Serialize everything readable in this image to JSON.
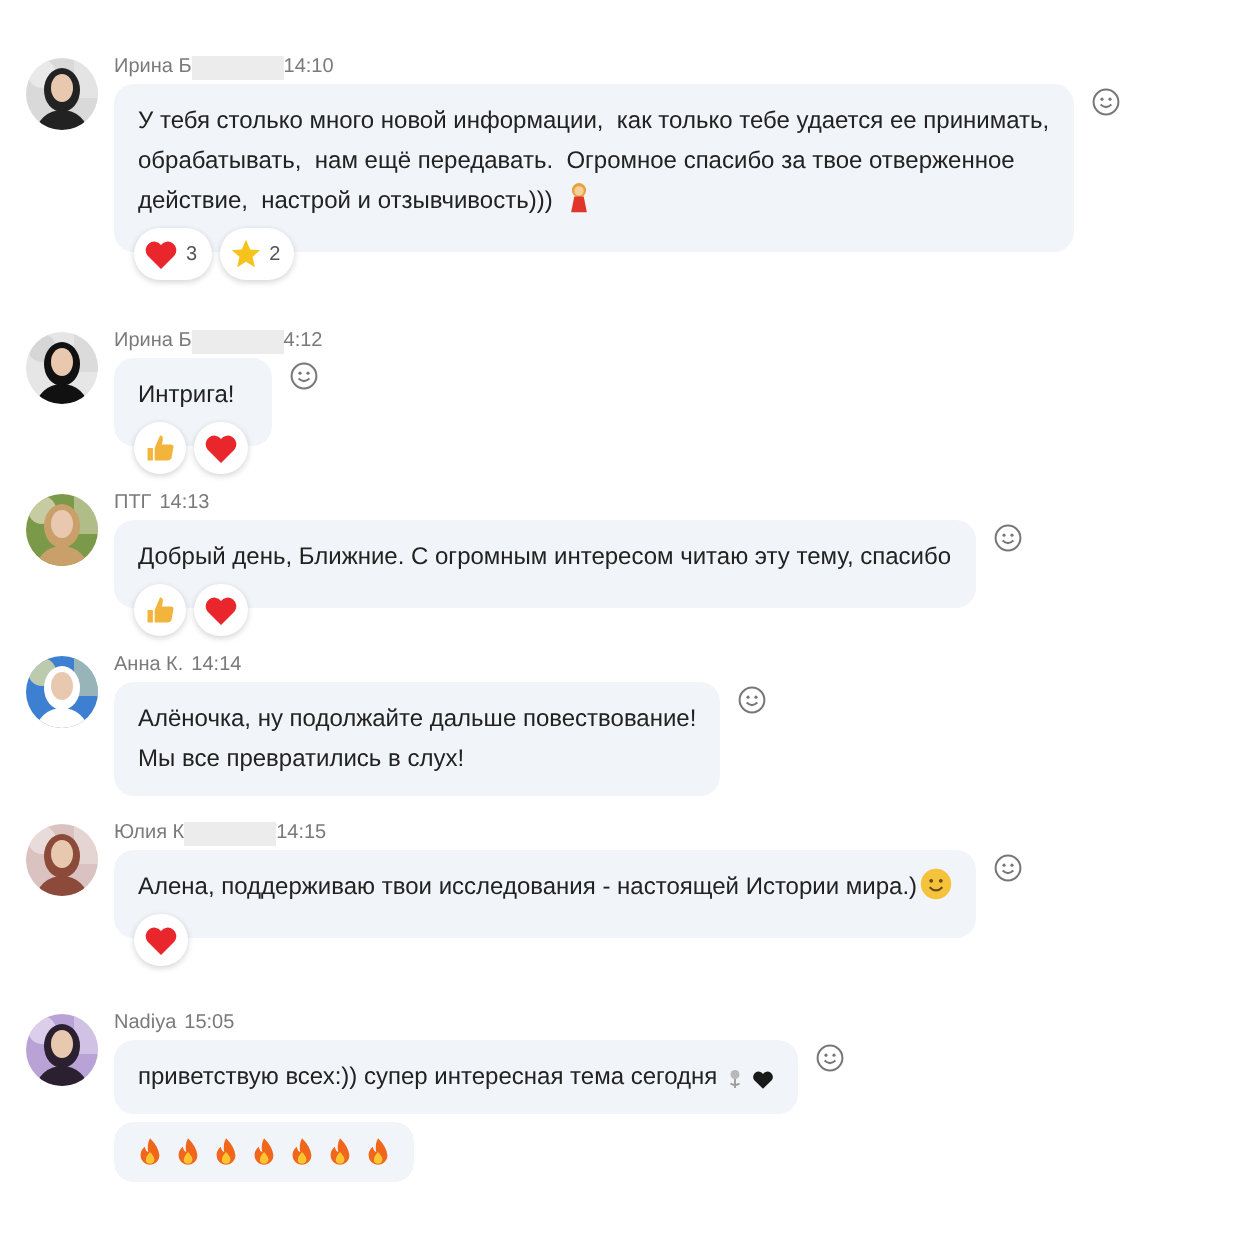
{
  "messages": [
    {
      "author": "Ирина Б",
      "redacted": true,
      "time": "14:10",
      "lines": [
        "У тебя столько много новой информации,  как только тебе удается ее принимать,",
        "обрабатывать,  нам ещё передавать.  Огромное спасибо за твое отверженное",
        "действие,  настрой и отзывчивость)))"
      ],
      "inline_emoji": [
        {
          "kind": "girl"
        }
      ],
      "reactions": [
        {
          "kind": "heart",
          "count": "3"
        },
        {
          "kind": "star",
          "count": "2"
        }
      ]
    },
    {
      "author": "Ирина Б",
      "redacted": true,
      "time": "4:12",
      "text": "Интрига!",
      "reactions": [
        {
          "kind": "thumbs"
        },
        {
          "kind": "heart"
        }
      ]
    },
    {
      "author": "ПТГ",
      "redacted": false,
      "time": "14:13",
      "text": "Добрый день, Ближние. С огромным интересом читаю эту тему, спасибо",
      "reactions": [
        {
          "kind": "thumbs"
        },
        {
          "kind": "heart"
        }
      ]
    },
    {
      "author": "Анна К.",
      "redacted": false,
      "time": "14:14",
      "lines": [
        "Алёночка, ну подолжайте дальше повествование!",
        "Мы все превратились в слух!"
      ]
    },
    {
      "author": "Юлия К",
      "redacted": true,
      "time": "14:15",
      "text": "Алена, поддерживаю твои исследования - настоящей Истории мира.)",
      "inline_emoji": [
        {
          "kind": "smiley"
        }
      ],
      "reactions": [
        {
          "kind": "heart"
        }
      ]
    },
    {
      "author": "Nadiya",
      "redacted": false,
      "time": "15:05",
      "text": "приветствую всех:)) супер интересная тема сегодня",
      "inline_emoji": [
        {
          "kind": "flower"
        },
        {
          "kind": "black-heart"
        }
      ],
      "emoji_message": [
        {
          "kind": "fire"
        },
        {
          "kind": "fire"
        },
        {
          "kind": "fire"
        },
        {
          "kind": "fire"
        },
        {
          "kind": "fire"
        },
        {
          "kind": "fire"
        },
        {
          "kind": "fire"
        }
      ]
    }
  ]
}
